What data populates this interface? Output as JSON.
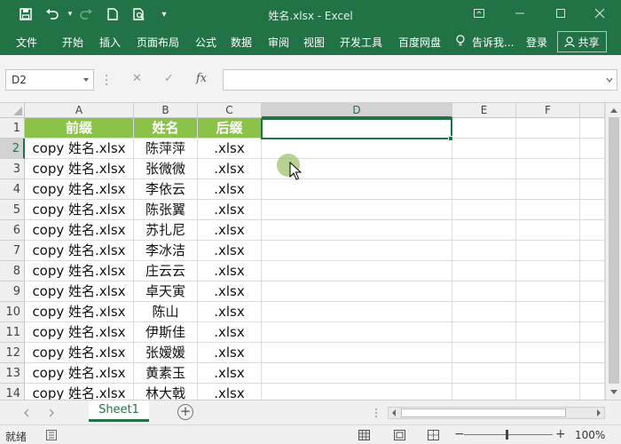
{
  "window": {
    "title": "姓名.xlsx - Excel",
    "accent": "#217346"
  },
  "ribbon": {
    "tabs": [
      "文件",
      "开始",
      "插入",
      "页面布局",
      "公式",
      "数据",
      "审阅",
      "视图",
      "开发工具",
      "百度网盘"
    ],
    "tell_me": "告诉我...",
    "login": "登录",
    "share": "共享"
  },
  "formula_bar": {
    "name_box": "D2",
    "formula": "",
    "fx_label": "fx"
  },
  "grid": {
    "columns": [
      "A",
      "B",
      "C",
      "D",
      "E",
      "F"
    ],
    "selected_column": "D",
    "selected_row": 2,
    "header_fill": "#8bc34a",
    "rows": [
      {
        "num": "1",
        "cells": [
          "前缀",
          "姓名",
          "后缀"
        ]
      },
      {
        "num": "2",
        "cells": [
          "copy 姓名.xlsx",
          "陈萍萍",
          ".xlsx"
        ]
      },
      {
        "num": "3",
        "cells": [
          "copy 姓名.xlsx",
          "张微微",
          ".xlsx"
        ]
      },
      {
        "num": "4",
        "cells": [
          "copy 姓名.xlsx",
          "李依云",
          ".xlsx"
        ]
      },
      {
        "num": "5",
        "cells": [
          "copy 姓名.xlsx",
          "陈张翼",
          ".xlsx"
        ]
      },
      {
        "num": "6",
        "cells": [
          "copy 姓名.xlsx",
          "苏扎尼",
          ".xlsx"
        ]
      },
      {
        "num": "7",
        "cells": [
          "copy 姓名.xlsx",
          "李冰洁",
          ".xlsx"
        ]
      },
      {
        "num": "8",
        "cells": [
          "copy 姓名.xlsx",
          "庄云云",
          ".xlsx"
        ]
      },
      {
        "num": "9",
        "cells": [
          "copy 姓名.xlsx",
          "卓天寅",
          ".xlsx"
        ]
      },
      {
        "num": "10",
        "cells": [
          "copy 姓名.xlsx",
          "陈山",
          ".xlsx"
        ]
      },
      {
        "num": "11",
        "cells": [
          "copy 姓名.xlsx",
          "伊斯佳",
          ".xlsx"
        ]
      },
      {
        "num": "12",
        "cells": [
          "copy 姓名.xlsx",
          "张嫒媛",
          ".xlsx"
        ]
      },
      {
        "num": "13",
        "cells": [
          "copy 姓名.xlsx",
          "黄素玉",
          ".xlsx"
        ]
      },
      {
        "num": "14",
        "cells": [
          "copy 姓名.xlsx",
          "林大戟",
          ".xlsx"
        ]
      }
    ]
  },
  "sheets": {
    "active": "Sheet1"
  },
  "status": {
    "ready": "就绪",
    "zoom": "100%"
  }
}
